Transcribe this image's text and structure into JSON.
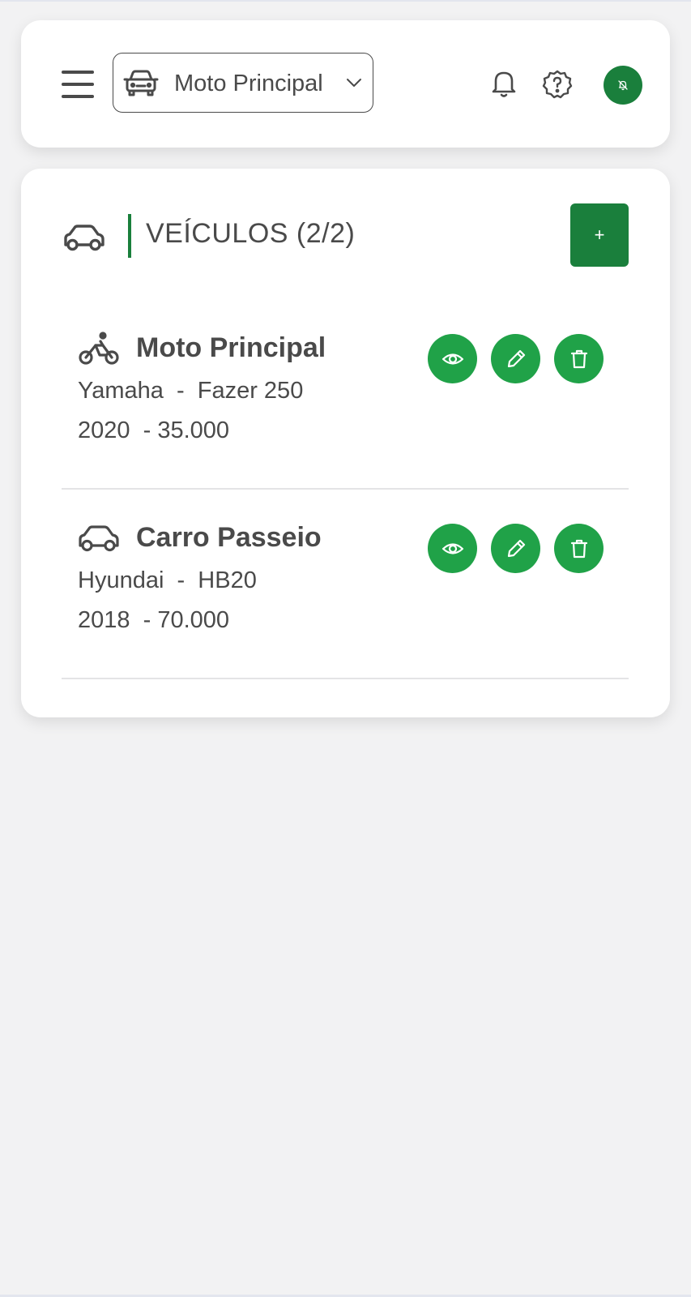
{
  "header": {
    "selected_vehicle": "Moto Principal",
    "icons": {
      "menu": "hamburger-menu-icon",
      "vehicle": "car-front-icon",
      "dropdown": "chevron-down-icon",
      "notifications": "bell-icon",
      "help": "help-badge-icon",
      "avatar": "bell-off-icon"
    }
  },
  "vehicles_section": {
    "title": "VEÍCULOS (2/2)",
    "add_label": "+",
    "icon": "car-side-icon",
    "accent_color": "#1a7f3c"
  },
  "vehicles": [
    {
      "name": "Moto Principal",
      "type_icon": "motorcycle-icon",
      "brand": "Yamaha",
      "model": "Fazer 250",
      "year": "2020",
      "km": "35.000",
      "line1": "Yamaha  -  Fazer 250",
      "line2": "2020  - 35.000"
    },
    {
      "name": "Carro Passeio",
      "type_icon": "car-side-icon",
      "brand": "Hyundai",
      "model": "HB20",
      "year": "2018",
      "km": "70.000",
      "line1": "Hyundai  -  HB20",
      "line2": "2018  - 70.000"
    }
  ],
  "actions": {
    "view_icon": "eye-icon",
    "edit_icon": "pencil-icon",
    "delete_icon": "trash-icon",
    "button_color": "#20a248"
  }
}
